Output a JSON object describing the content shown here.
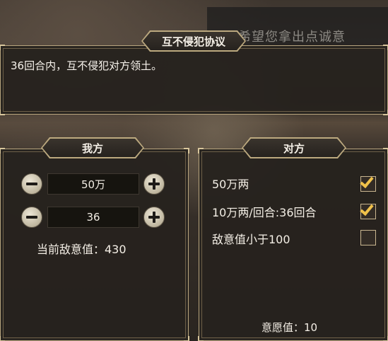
{
  "background_hint": "希望您拿出点诚意",
  "agreement": {
    "title": "互不侵犯协议",
    "description": "36回合内，互不侵犯对方领土。"
  },
  "our_side": {
    "title": "我方",
    "gold_value": "50万",
    "turns_value": "36",
    "enmity_label": "当前敌意值：430"
  },
  "their_side": {
    "title": "对方",
    "options": [
      {
        "label": "50万两",
        "checked": true
      },
      {
        "label": "10万两/回合:36回合",
        "checked": true
      },
      {
        "label": "敌意值小于100",
        "checked": false
      }
    ],
    "willingness_label": "意愿值：10"
  },
  "colors": {
    "frame_gold": "#bca97f",
    "check_yellow": "#f0c14a",
    "panel_dark": "#26221e"
  }
}
